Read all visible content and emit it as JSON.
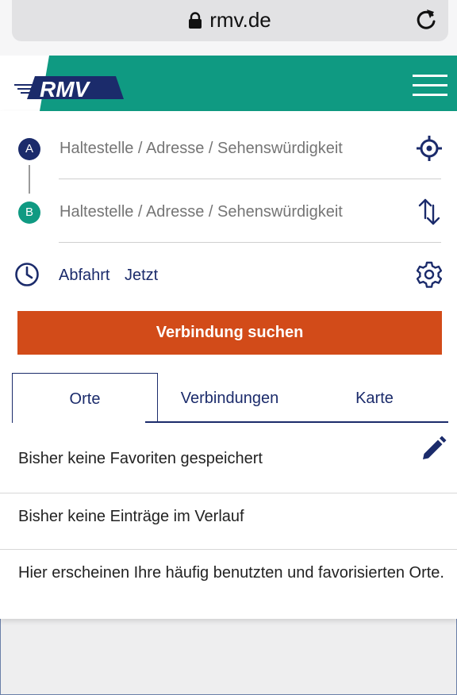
{
  "browser": {
    "url": "rmv.de"
  },
  "header": {
    "logo_text": "RMV",
    "colors": {
      "green": "#0f9a82",
      "navy": "#1b2b6b"
    }
  },
  "route": {
    "from": {
      "badge": "A",
      "placeholder": "Haltestelle / Adresse / Sehenswürdigkeit",
      "value": ""
    },
    "to": {
      "badge": "B",
      "placeholder": "Haltestelle / Adresse / Sehenswürdigkeit",
      "value": ""
    }
  },
  "time": {
    "mode": "Abfahrt",
    "value": "Jetzt"
  },
  "search_button": {
    "label": "Verbindung suchen",
    "color": "#d24b19"
  },
  "tabs": [
    {
      "label": "Orte",
      "active": true
    },
    {
      "label": "Verbindungen",
      "active": false
    },
    {
      "label": "Karte",
      "active": false
    }
  ],
  "lists": {
    "favorites": "Bisher keine Favoriten gespeichert",
    "history": "Bisher keine Einträge im Verlauf",
    "info": "Hier erscheinen Ihre häufig benutzten und favorisierten Orte."
  },
  "icons": [
    "lock-icon",
    "reload-icon",
    "menu-icon",
    "locate-icon",
    "swap-icon",
    "clock-icon",
    "settings-icon",
    "edit-icon"
  ]
}
